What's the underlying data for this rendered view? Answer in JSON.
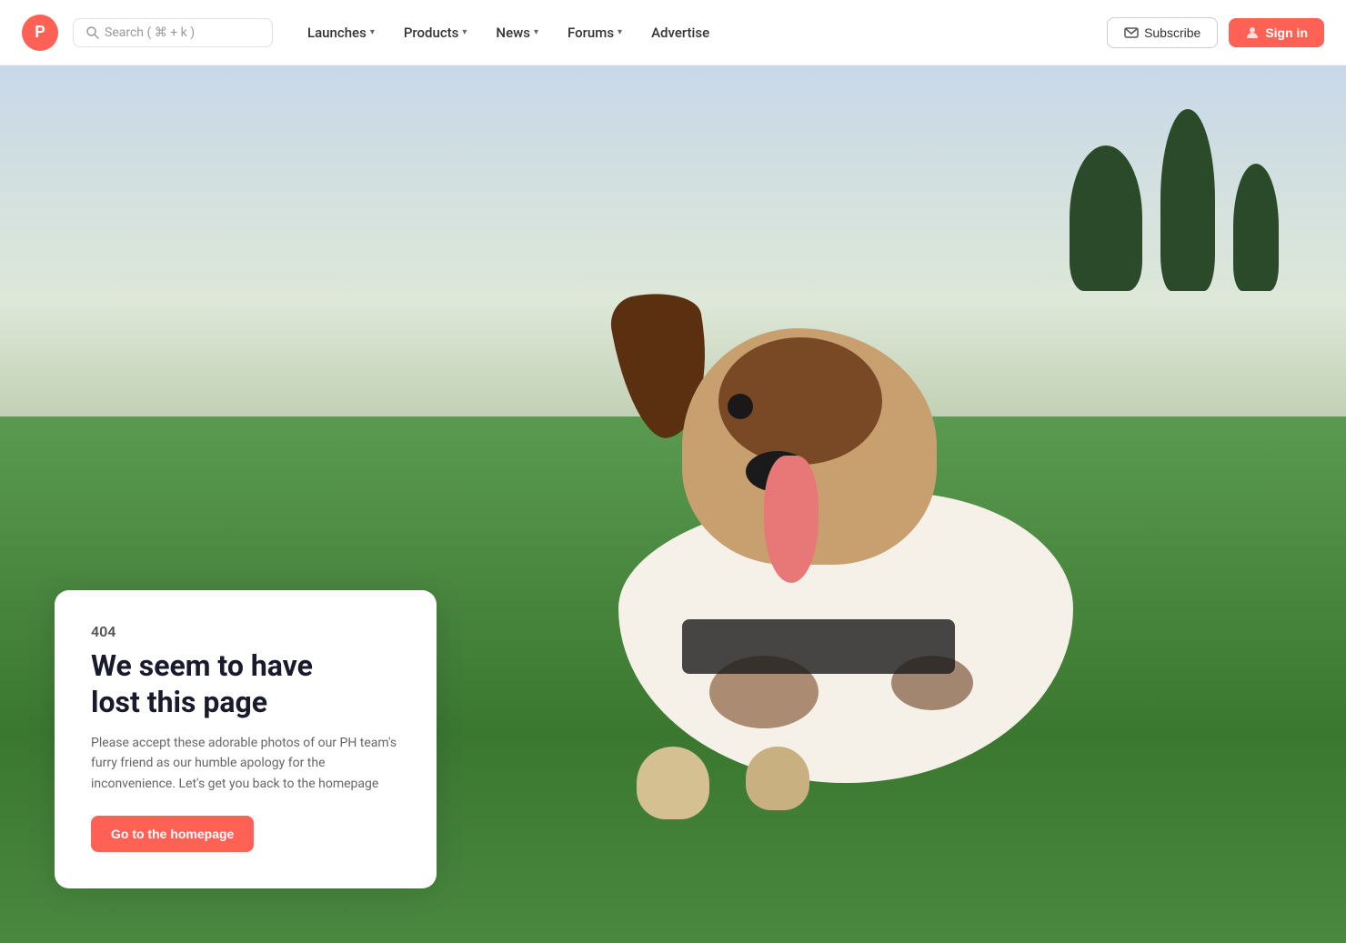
{
  "brand": {
    "logo_letter": "P",
    "logo_bg": "#ff6154"
  },
  "search": {
    "placeholder": "Search ( ⌘ + k )"
  },
  "nav": {
    "items": [
      {
        "label": "Launches",
        "has_dropdown": true
      },
      {
        "label": "Products",
        "has_dropdown": true
      },
      {
        "label": "News",
        "has_dropdown": true
      },
      {
        "label": "Forums",
        "has_dropdown": true
      },
      {
        "label": "Advertise",
        "has_dropdown": false
      }
    ],
    "subscribe_label": "Subscribe",
    "signin_label": "Sign in"
  },
  "error_page": {
    "code": "404",
    "title_line1": "We seem to have",
    "title_line2": "lost this page",
    "description": "Please accept these adorable photos of our PH team's furry friend as our humble apology for the inconvenience. Let's get you back to the homepage",
    "cta_label": "Go to the homepage"
  }
}
